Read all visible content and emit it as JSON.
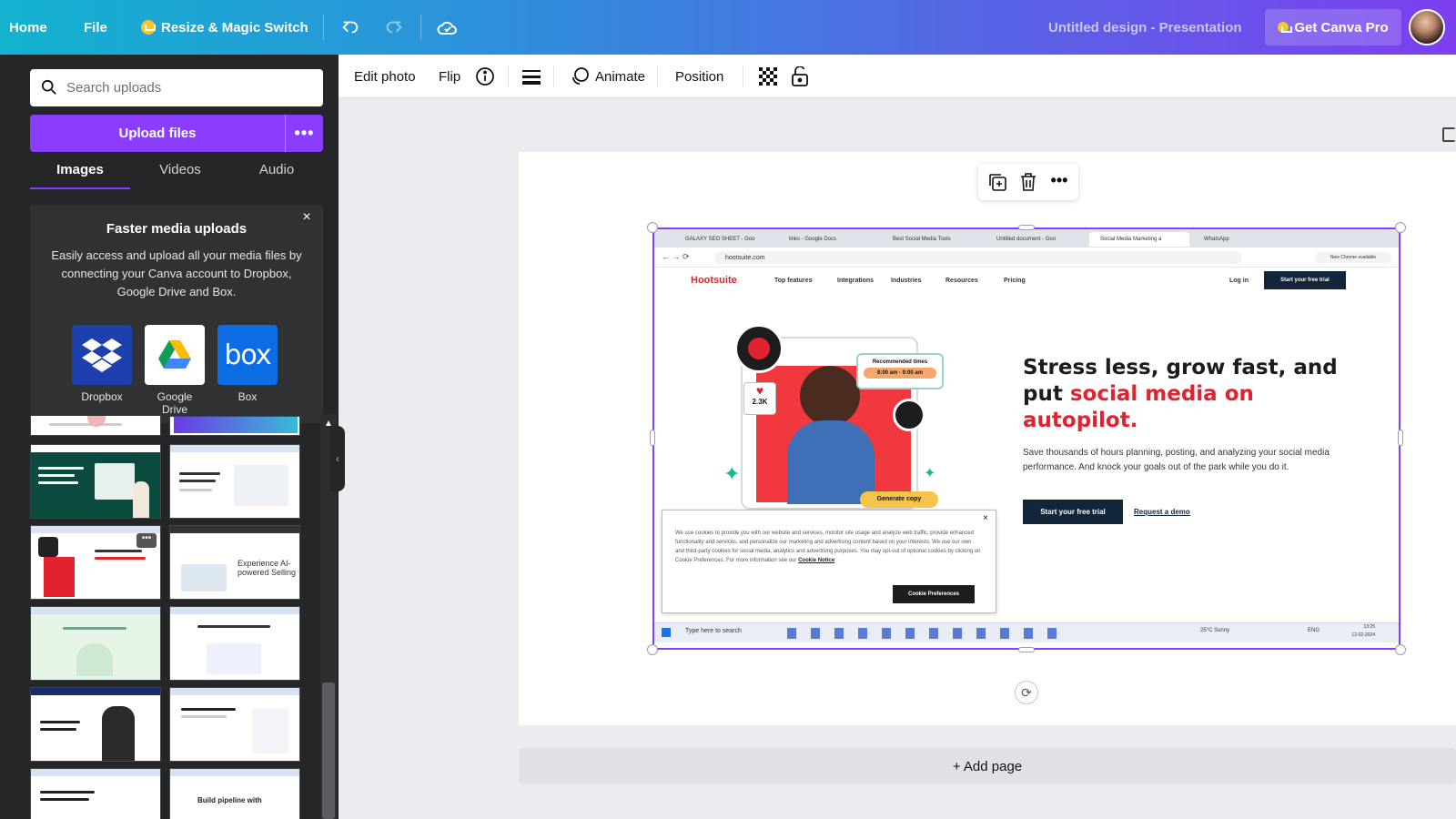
{
  "topbar": {
    "home": "Home",
    "file": "File",
    "resize": "Resize & Magic Switch",
    "title": "Untitled design - Presentation",
    "pro": "Get Canva Pro"
  },
  "sidebar": {
    "search_placeholder": "Search uploads",
    "upload_label": "Upload files",
    "tabs": [
      "Images",
      "Videos",
      "Audio"
    ],
    "promo": {
      "title": "Faster media uploads",
      "body": "Easily access and upload all your media files by connecting your Canva account to Dropbox, Google Drive and Box.",
      "services": [
        "Dropbox",
        "Google Drive",
        "Box"
      ]
    },
    "thumbs": [
      {
        "text": ""
      },
      {
        "text": ""
      },
      {
        "text": ""
      },
      {
        "text": ""
      },
      {
        "text": ""
      },
      {
        "text": "Experience AI-powered Selling"
      },
      {
        "text": ""
      },
      {
        "text": ""
      },
      {
        "text": ""
      },
      {
        "text": ""
      },
      {
        "text": ""
      },
      {
        "text": "Build pipeline with"
      }
    ]
  },
  "toolbar": {
    "edit_photo": "Edit photo",
    "flip": "Flip",
    "animate": "Animate",
    "position": "Position"
  },
  "canvas": {
    "add_page": "+ Add page"
  },
  "screenshot": {
    "tabs": [
      "GALAXY SEO SHEET - Goo",
      "links - Google Docs",
      "Best Social Media Tools",
      "Untitled document - Goo",
      "Social Media Marketing a",
      "WhatsApp"
    ],
    "url": "hootsuite.com",
    "chrome_badge": "New Chrome available",
    "brand": "Hootsuite",
    "nav": [
      "Top features",
      "Integrations",
      "Industries",
      "Resources",
      "Pricing"
    ],
    "login": "Log in",
    "trial_btn": "Start your free trial",
    "headline_a": "Stress less, grow fast, and put ",
    "headline_b": "social media on autopilot.",
    "subhead": "Save thousands of hours planning, posting, and analyzing your social media performance. And knock your goals out of the park while you do it.",
    "cta": "Start your free trial",
    "demo": "Request a demo",
    "likes": "2.3K",
    "rec_title": "Recommended times",
    "rec_time": "8:00 am - 9:00 am",
    "gen_copy": "Generate copy",
    "cookie_text": "We use cookies to provide you with our website and services, monitor site usage and analyze web traffic, provide enhanced functionality and services, and personalize our marketing and advertising content based on your interests. We use our own and third-party cookies for social media, analytics and advertising purposes. You may opt-out of optional cookies by clicking on Cookie Preferences. For more information see our",
    "cookie_link": "Cookie Notice",
    "cookie_btn": "Cookie Preferences",
    "taskbar_search": "Type here to search",
    "weather": "25°C  Sunny",
    "lang": "ENG",
    "time": "13:25",
    "date": "12-02-2024"
  },
  "colors": {
    "accent": "#8b3dff",
    "hootsuite_red": "#e0232e",
    "sidebar_bg": "#252627"
  }
}
